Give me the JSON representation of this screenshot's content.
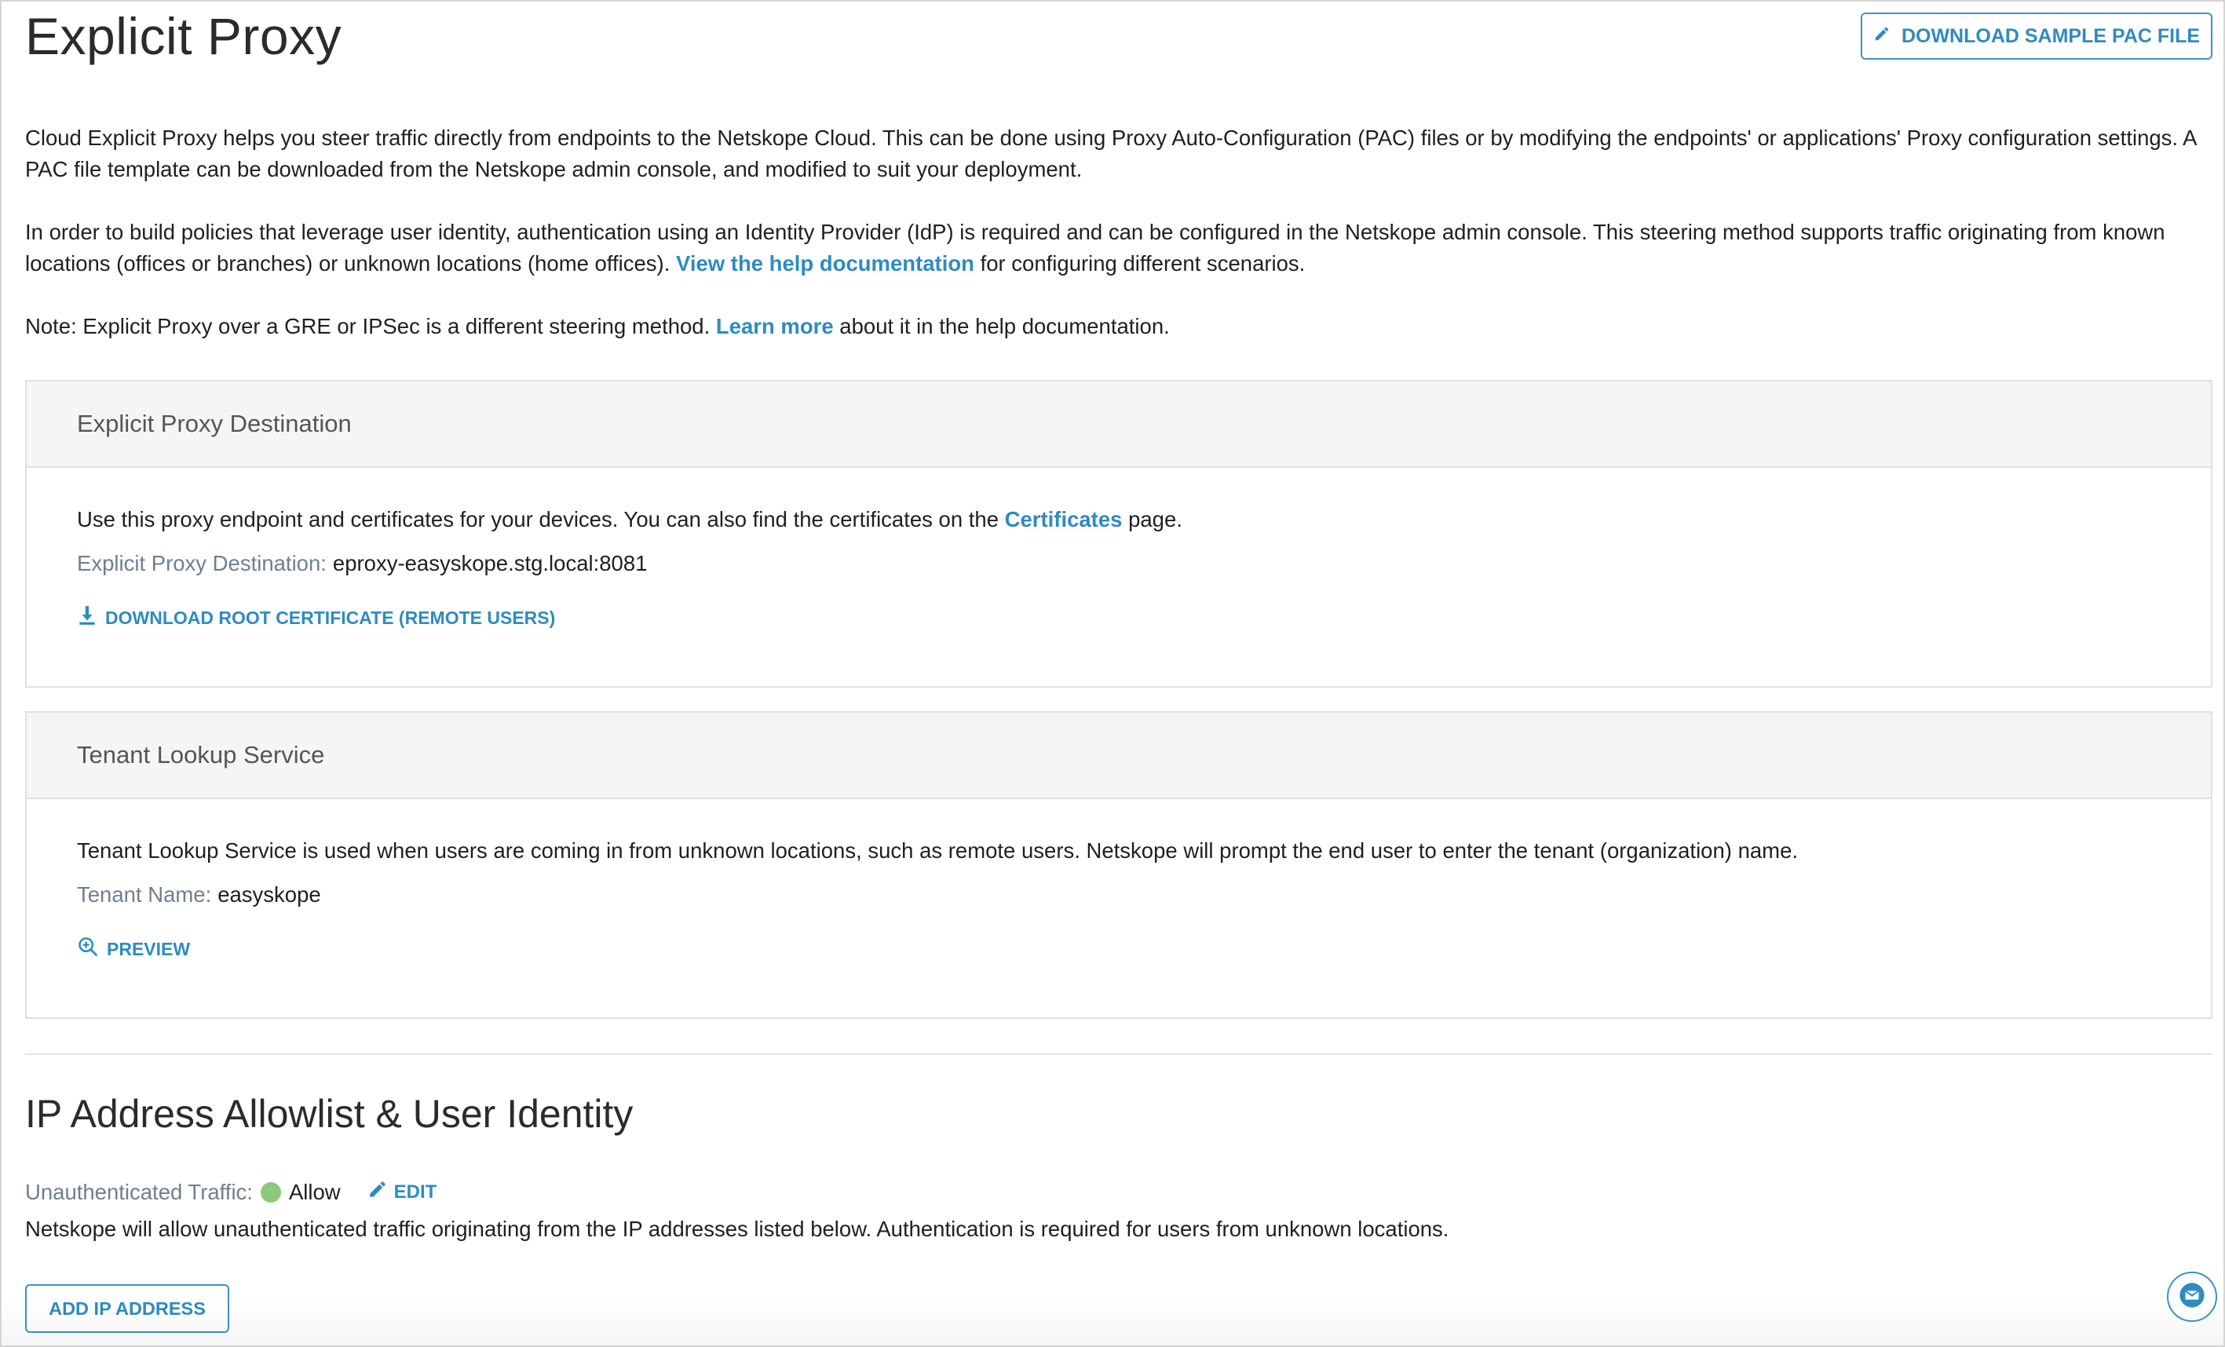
{
  "page": {
    "title": "Explicit Proxy",
    "download_pac_label": "DOWNLOAD SAMPLE PAC FILE"
  },
  "intro": {
    "p1": "Cloud Explicit Proxy helps you steer traffic directly from endpoints to the Netskope Cloud. This can be done using Proxy Auto-Configuration (PAC) files or by modifying the endpoints' or applications' Proxy configuration settings. A PAC file template can be downloaded from the Netskope admin console, and modified to suit your deployment.",
    "p2_before": "In order to build policies that leverage user identity, authentication using an Identity Provider (IdP) is required and can be configured in the Netskope admin console. This steering method supports traffic originating from known locations (offices or branches) or unknown locations (home offices). ",
    "p2_link": "View the help documentation",
    "p2_after": " for configuring different scenarios.",
    "p3_before": "Note: Explicit Proxy over a GRE or IPSec is a different steering method. ",
    "p3_link": "Learn more",
    "p3_after": " about it in the help documentation."
  },
  "destination_card": {
    "title": "Explicit Proxy Destination",
    "desc_before": "Use this proxy endpoint and certificates for your devices. You can also find the certificates on the ",
    "desc_link": "Certificates",
    "desc_after": " page.",
    "label": "Explicit Proxy Destination:",
    "value": "eproxy-easyskope.stg.local:8081",
    "download_label": "DOWNLOAD ROOT CERTIFICATE (REMOTE USERS)"
  },
  "tenant_card": {
    "title": "Tenant Lookup Service",
    "desc": "Tenant Lookup Service is used when users are coming in from unknown locations, such as remote users. Netskope will prompt the end user to enter the tenant (organization) name.",
    "label": "Tenant Name:",
    "value": "easyskope",
    "preview_label": "PREVIEW"
  },
  "allowlist": {
    "title": "IP Address Allowlist & User Identity",
    "status_label": "Unauthenticated Traffic:",
    "status_value": "Allow",
    "status_color": "#8cc97a",
    "edit_label": "EDIT",
    "description": "Netskope will allow unauthenticated traffic originating from the IP addresses listed below. Authentication is required for users from unknown locations.",
    "add_ip_label": "ADD IP ADDRESS"
  },
  "colors": {
    "accent": "#2f8bc0",
    "border_accent": "#3a93c6"
  },
  "icons": {
    "pac": "pencil-icon",
    "download": "download-icon",
    "preview": "zoom-in-icon",
    "edit": "pencil-icon",
    "mail": "mail-icon"
  }
}
